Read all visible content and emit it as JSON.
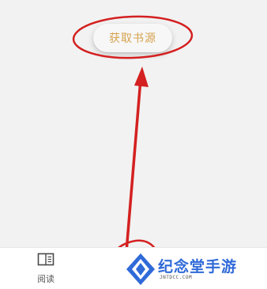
{
  "main": {
    "get_source_label": "获取书源"
  },
  "bottom_nav": {
    "items": [
      {
        "label": "阅读",
        "icon": "book-open-icon"
      }
    ]
  },
  "watermark": {
    "text": "纪念堂手游",
    "url": "JNTDCC.COM",
    "icon": "diamond-logo-icon"
  },
  "colors": {
    "background": "#f2f2f2",
    "button_text": "#d6a24e",
    "annotation": "#d42020",
    "watermark_blue": "#2f6ad8"
  }
}
